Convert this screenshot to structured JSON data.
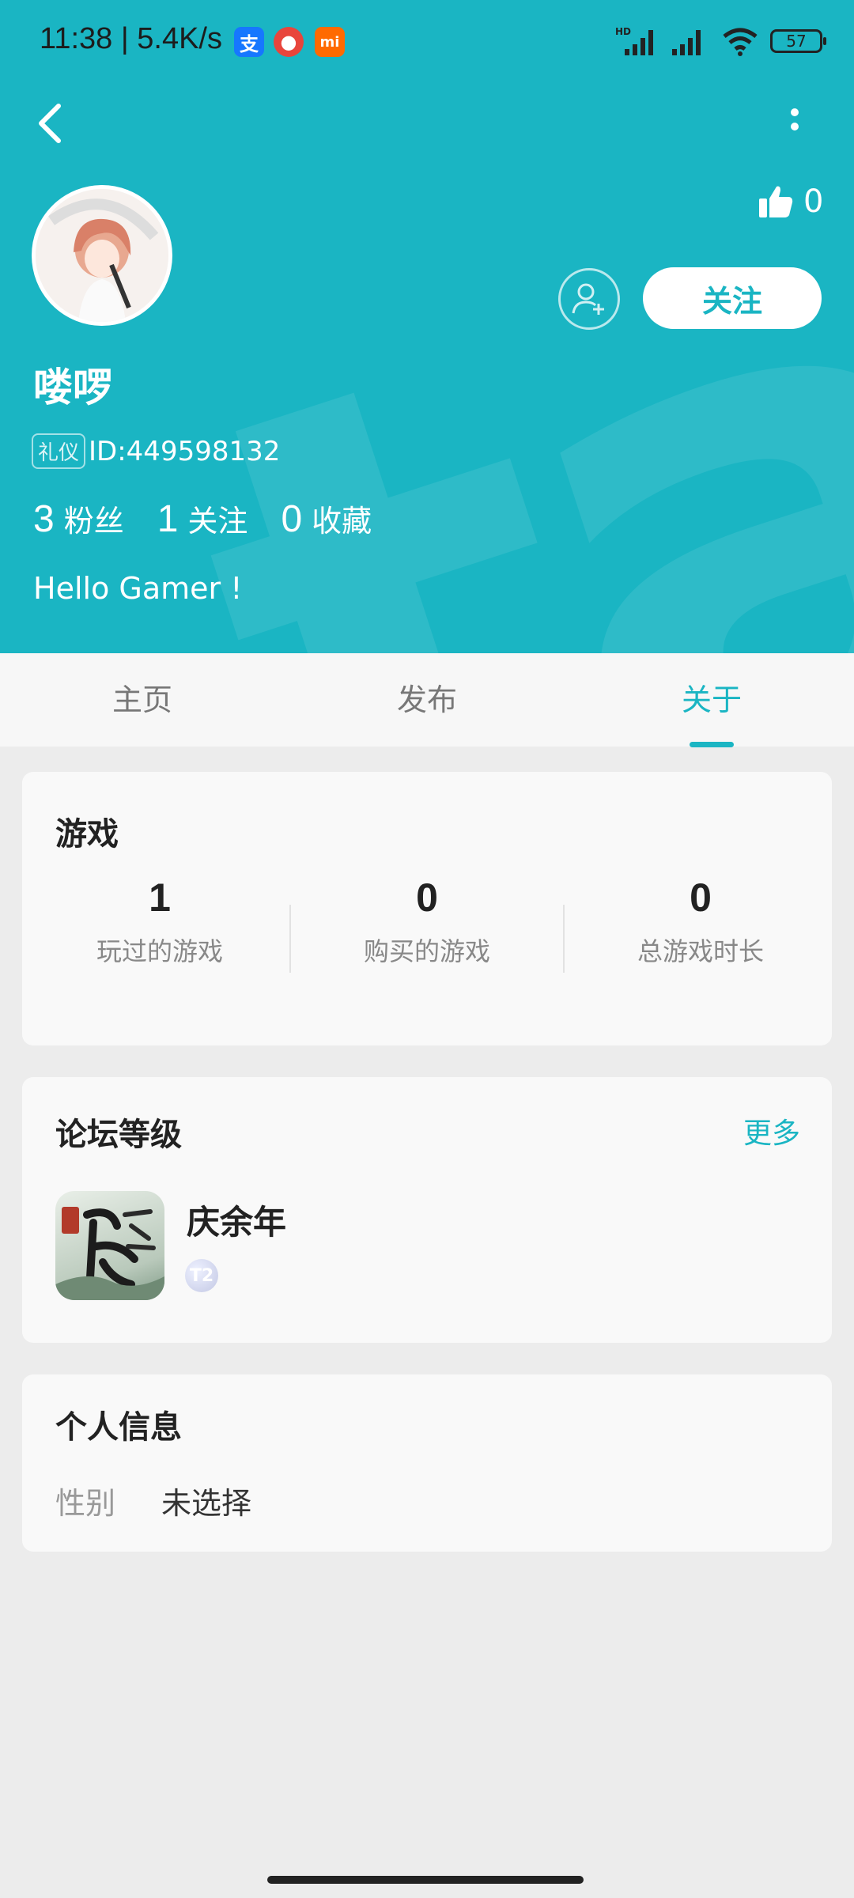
{
  "status_bar": {
    "time": "11:38 | 5.4K/s",
    "battery": "57",
    "signal_label": "HD"
  },
  "profile": {
    "likes": "0",
    "follow_label": "关注",
    "username": "喽啰",
    "badge": "礼仪",
    "id_text": "ID:449598132",
    "stats": [
      {
        "num": "3",
        "label": "粉丝"
      },
      {
        "num": "1",
        "label": "关注"
      },
      {
        "num": "0",
        "label": "收藏"
      }
    ],
    "bio": "Hello Gamer !",
    "watermark": "tapta"
  },
  "tabs": [
    {
      "label": "主页"
    },
    {
      "label": "发布"
    },
    {
      "label": "关于"
    }
  ],
  "active_tab": "关于",
  "games_card": {
    "title": "游戏",
    "stats": [
      {
        "num": "1",
        "label": "玩过的游戏"
      },
      {
        "num": "0",
        "label": "购买的游戏"
      },
      {
        "num": "0",
        "label": "总游戏时长"
      }
    ]
  },
  "forum_card": {
    "title": "论坛等级",
    "more": "更多",
    "game_name": "庆余年",
    "level": "T2"
  },
  "info_card": {
    "title": "个人信息",
    "label": "性别",
    "value": "未选择"
  },
  "colors": {
    "accent": "#1ab5c3",
    "background": "#ececec"
  }
}
